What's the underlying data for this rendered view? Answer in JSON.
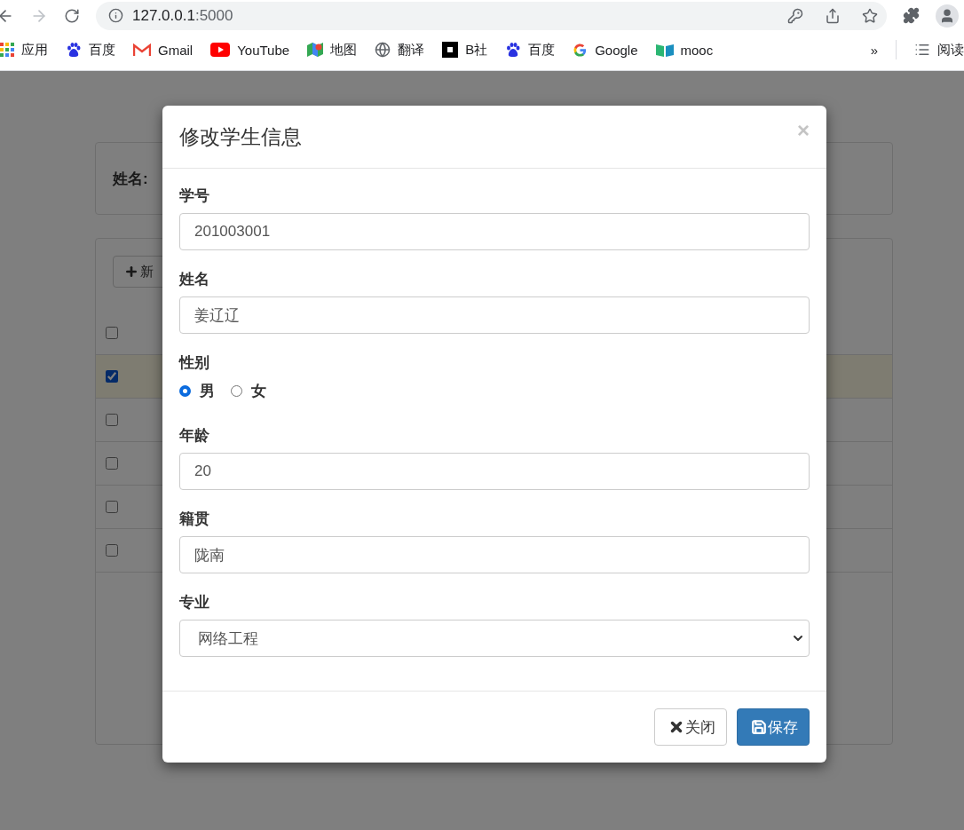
{
  "browser": {
    "url_host": "127.0.0.1",
    "url_port": ":5000",
    "bookmarks": [
      {
        "label": "应用",
        "kind": "apps"
      },
      {
        "label": "百度",
        "kind": "paw"
      },
      {
        "label": "Gmail",
        "kind": "mail"
      },
      {
        "label": "YouTube",
        "kind": "play"
      },
      {
        "label": "地图",
        "kind": "map"
      },
      {
        "label": "翻译",
        "kind": "globe"
      },
      {
        "label": "B社",
        "kind": "square"
      },
      {
        "label": "百度",
        "kind": "paw"
      },
      {
        "label": "Google",
        "kind": "g"
      },
      {
        "label": "mooc",
        "kind": "book"
      }
    ],
    "overflow": "»",
    "reading_list": "阅读"
  },
  "page": {
    "search_label": "姓名:",
    "add_button": "新",
    "rows": [
      {
        "checked": false
      },
      {
        "checked": true
      },
      {
        "checked": false
      },
      {
        "checked": false
      },
      {
        "checked": false
      },
      {
        "checked": false
      }
    ]
  },
  "modal": {
    "title": "修改学生信息",
    "close": "×",
    "fields": [
      {
        "kind": "text",
        "label": "学号",
        "value": "201003001"
      },
      {
        "kind": "text",
        "label": "姓名",
        "value": "姜辽辽"
      },
      {
        "kind": "radio",
        "label": "性别",
        "options": [
          {
            "label": "男",
            "selected": true
          },
          {
            "label": "女",
            "selected": false
          }
        ]
      },
      {
        "kind": "text",
        "label": "年龄",
        "value": "20"
      },
      {
        "kind": "text",
        "label": "籍贯",
        "value": "陇南"
      },
      {
        "kind": "select",
        "label": "专业",
        "value": "网络工程"
      }
    ],
    "buttons": [
      {
        "label": "关闭",
        "kind": "close"
      },
      {
        "label": "保存",
        "kind": "save"
      }
    ]
  }
}
